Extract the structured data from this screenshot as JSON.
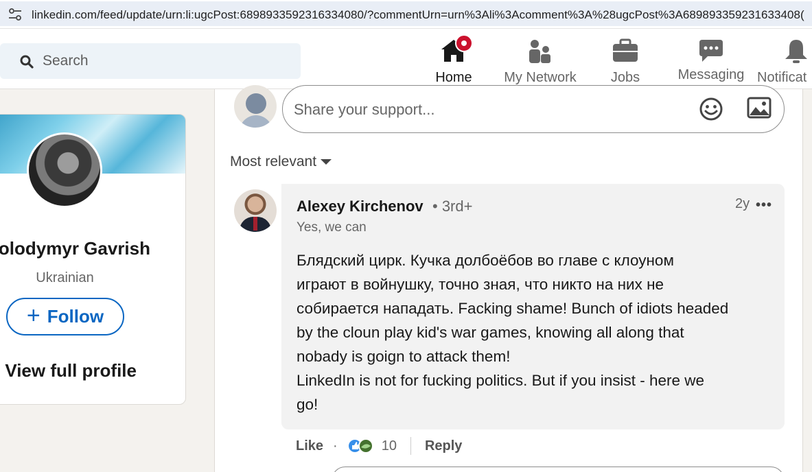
{
  "browser": {
    "url": "linkedin.com/feed/update/urn:li:ugcPost:6898933592316334080/?commentUrn=urn%3Ali%3Acomment%3A%28ugcPost%3A689893359231633408("
  },
  "header": {
    "search_placeholder": "Search",
    "nav": {
      "home": "Home",
      "network": "My Network",
      "jobs": "Jobs",
      "messaging": "Messaging",
      "notifications": "Notificat"
    }
  },
  "profile_card": {
    "name": "olodymyr Gavrish",
    "headline": "Ukrainian",
    "follow_label": "Follow",
    "follow_plus": "+",
    "view_full": "View full profile"
  },
  "composer": {
    "placeholder": "Share your support..."
  },
  "sort": {
    "label": "Most relevant"
  },
  "comment": {
    "author": "Alexey Kirchenov",
    "degree": "• 3rd+",
    "subtitle": "Yes, we can",
    "time": "2y",
    "more": "•••",
    "text": "Блядский цирк. Кучка долбоёбов во главе с клоуном\nиграют в войнушку, точно зная, что никто на них не\nсобирается нападать. Facking shame! Bunch of idiots headed\nby the cloun play kid's war games, knowing all along that\nnobady is goign to attack them!\nLinkedIn is not for fucking politics. But if you insist - here we\ngo!",
    "like_label": "Like",
    "dot": "·",
    "reaction_count": "10",
    "reply_label": "Reply"
  },
  "colors": {
    "linkedin_blue": "#0a66c2",
    "badge_red": "#cb112d",
    "bubble_bg": "#f2f2f2",
    "page_bg": "#f4f2ee"
  }
}
